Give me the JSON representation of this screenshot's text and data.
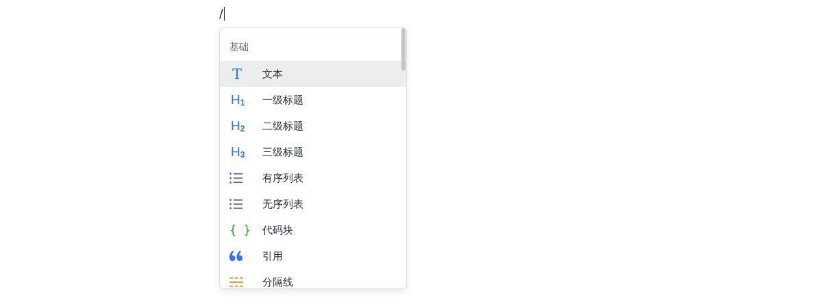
{
  "editor": {
    "text": "/"
  },
  "menu": {
    "section": "基础",
    "items": [
      {
        "kind": "text",
        "icon": "T",
        "label": "文本",
        "selected": true
      },
      {
        "kind": "heading",
        "icon": "H$_{1}$",
        "label": "一级标题",
        "selected": false
      },
      {
        "kind": "heading",
        "icon": "H$_{2}$",
        "label": "二级标题",
        "selected": false
      },
      {
        "kind": "heading",
        "icon": "H$_{3}$",
        "label": "三级标题",
        "selected": false
      },
      {
        "kind": "ordered",
        "label": "有序列表",
        "selected": false
      },
      {
        "kind": "bullet",
        "label": "无序列表",
        "selected": false
      },
      {
        "kind": "code",
        "icon": "{ }",
        "label": "代码块",
        "selected": false
      },
      {
        "kind": "quote",
        "label": "引用",
        "selected": false
      },
      {
        "kind": "divider",
        "label": "分隔线",
        "selected": false
      }
    ]
  }
}
